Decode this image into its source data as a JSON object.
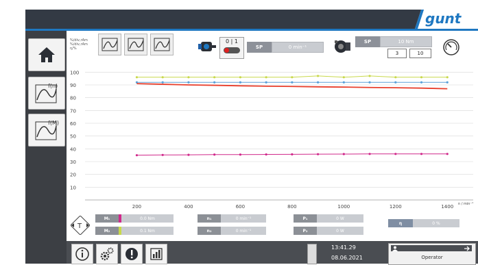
{
  "brand": {
    "logo_text": "gunt",
    "accent_color": "#1f78c1",
    "bar_color": "#333a44"
  },
  "sidebar": {
    "items": [
      {
        "name": "home",
        "icon": "home-icon"
      },
      {
        "name": "chart-f-n",
        "icon": "chart-function-icon",
        "label": "f(n)"
      },
      {
        "name": "chart-f-m",
        "icon": "chart-function-icon",
        "label": "f(M)"
      }
    ]
  },
  "toolbar": {
    "axis_legend": [
      "%/div,rAm",
      "%/div,rAm",
      "η/%"
    ],
    "pump_switch_label": "0 | 1",
    "sp1": {
      "label": "SP",
      "value": "0 min⁻¹"
    },
    "sp2": {
      "label": "SP",
      "value": "10 Nm",
      "box1": "3",
      "box2": "10"
    }
  },
  "chart": {
    "x_unit_label": "n / min⁻¹",
    "y_ticks": [
      "100",
      "90",
      "80",
      "70",
      "60",
      "50",
      "40",
      "30",
      "20",
      "10"
    ],
    "x_ticks": [
      "200",
      "400",
      "600",
      "800",
      "1000",
      "1200",
      "1400"
    ]
  },
  "chart_data": {
    "type": "line",
    "xlim": [
      0,
      1500
    ],
    "ylim": [
      0,
      105
    ],
    "x": [
      200,
      300,
      400,
      500,
      600,
      700,
      800,
      900,
      1000,
      1100,
      1200,
      1300,
      1400
    ],
    "series": [
      {
        "color": "#c8d84a",
        "values": [
          96,
          96,
          96,
          96,
          96,
          96,
          96,
          97,
          96,
          97,
          96,
          96,
          96
        ]
      },
      {
        "color": "#5aa0d8",
        "values": [
          92,
          92,
          92,
          92,
          92,
          92,
          92,
          92,
          92,
          92,
          92,
          92,
          92
        ]
      },
      {
        "color": "#e83e2b",
        "values": [
          91,
          90.5,
          90,
          89.7,
          89.3,
          89,
          88.8,
          88.5,
          88.3,
          88,
          87.8,
          87.5,
          87
        ]
      },
      {
        "color": "#d0288a",
        "values": [
          35,
          35.2,
          35.3,
          35.5,
          35.5,
          35.6,
          35.7,
          35.8,
          35.9,
          36,
          36,
          36,
          36
        ]
      }
    ]
  },
  "measurements": {
    "m1": {
      "label": "M₁",
      "value": "0.0 Nm"
    },
    "m2": {
      "label": "M₂",
      "value": "0.1 Nm"
    },
    "n1": {
      "label": "n₁",
      "value": "0 min⁻¹"
    },
    "n2": {
      "label": "n₂",
      "value": "0 min⁻¹"
    },
    "p1": {
      "label": "P₁",
      "value": "0 W"
    },
    "p2": {
      "label": "P₂",
      "value": "0 W"
    },
    "eta": {
      "label": "η",
      "value": "0 %"
    }
  },
  "footer": {
    "time": "13:41.29",
    "date": "08.06.2021",
    "user": "Operator"
  }
}
